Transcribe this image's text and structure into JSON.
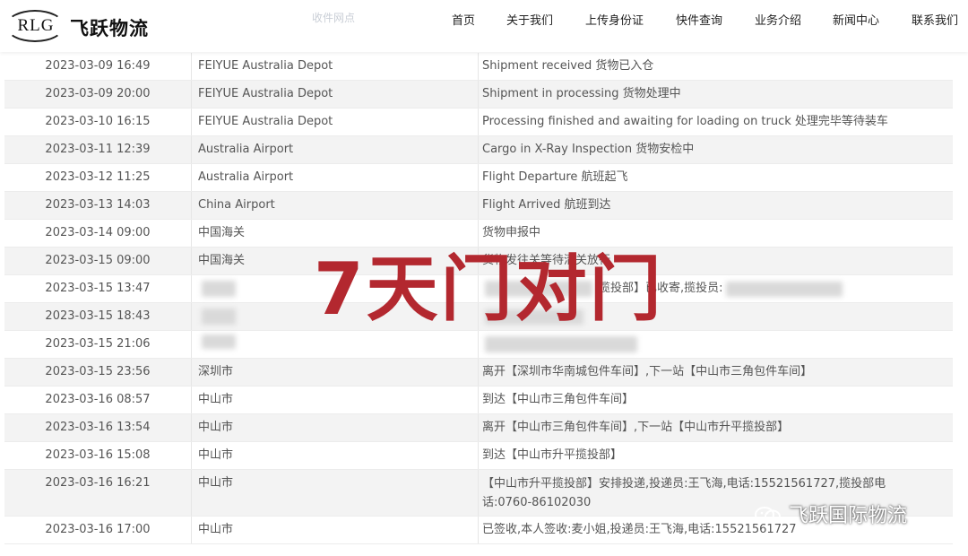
{
  "header": {
    "logo_text": "RLG",
    "company_name": "飞跃物流",
    "ghost_column": "收件网点",
    "nav": [
      "首页",
      "关于我们",
      "上传身份证",
      "快件查询",
      "业务介绍",
      "新闻中心",
      "联系我们"
    ]
  },
  "tracking": {
    "rows": [
      {
        "time": "2023-03-09 16:49",
        "location": "FEIYUE Australia Depot",
        "description": "Shipment received 货物已入仓"
      },
      {
        "time": "2023-03-09 20:00",
        "location": "FEIYUE Australia Depot",
        "description": "Shipment in processing 货物处理中"
      },
      {
        "time": "2023-03-10 16:15",
        "location": "FEIYUE Australia Depot",
        "description": "Processing finished and awaiting for loading on truck 处理完毕等待装车"
      },
      {
        "time": "2023-03-11 12:39",
        "location": "Australia Airport",
        "description": "Cargo in X-Ray Inspection 货物安检中"
      },
      {
        "time": "2023-03-12 11:25",
        "location": "Australia Airport",
        "description": "Flight Departure 航班起飞"
      },
      {
        "time": "2023-03-13 14:03",
        "location": "China Airport",
        "description": "Flight Arrived 航班到达"
      },
      {
        "time": "2023-03-14 09:00",
        "location": "中国海关",
        "description": "货物申报中"
      },
      {
        "time": "2023-03-15 09:00",
        "location": "中国海关",
        "description": "货物发往关等待清关放行"
      },
      {
        "time": "2023-03-15 13:47",
        "location": "",
        "description": "揽投部】已收寄,揽投员:"
      },
      {
        "time": "2023-03-15 18:43",
        "location": "",
        "description": ""
      },
      {
        "time": "2023-03-15 21:06",
        "location": "",
        "description": ""
      },
      {
        "time": "2023-03-15 23:56",
        "location": "深圳市",
        "description": "离开【深圳市华南城包件车间】,下一站【中山市三角包件车间】"
      },
      {
        "time": "2023-03-16 08:57",
        "location": "中山市",
        "description": "到达【中山市三角包件车间】"
      },
      {
        "time": "2023-03-16 13:54",
        "location": "中山市",
        "description": "离开【中山市三角包件车间】,下一站【中山市升平揽投部】"
      },
      {
        "time": "2023-03-16 15:08",
        "location": "中山市",
        "description": "到达【中山市升平揽投部】"
      },
      {
        "time": "2023-03-16 16:21",
        "location": "中山市",
        "description": "【中山市升平揽投部】安排投递,投递员:王飞海,电话:15521561727,揽投部电话:0760-86102030"
      },
      {
        "time": "2023-03-16 17:00",
        "location": "中山市",
        "description": "已签收,本人签收:麦小姐,投递员:王飞海,电话:15521561727"
      }
    ]
  },
  "overlay": {
    "text": "7天门对门"
  },
  "watermark": {
    "text": "飞跃国际物流"
  },
  "colors": {
    "overlay": "#b3282f",
    "row_alt": "#f3f3f3"
  }
}
